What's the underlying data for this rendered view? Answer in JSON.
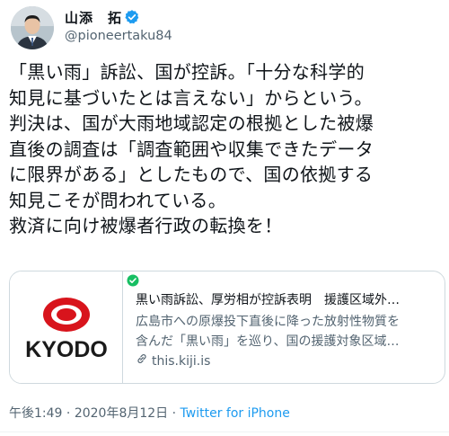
{
  "user": {
    "display_name": "山添　拓",
    "handle": "@pioneertaku84"
  },
  "tweet": {
    "text_lines": [
      "「黒い雨」訴訟、国が控訴。「十分な科学的",
      "知見に基づいたとは言えない」からという。",
      "判決は、国が大雨地域認定の根拠とした被爆",
      "直後の調査は「調査範囲や収集できたデータ",
      "に限界がある」としたもので、国の依拠する",
      "知見こそが問われている。",
      "救済に向け被爆者行政の転換を！"
    ]
  },
  "card": {
    "logo_text": "KYODO",
    "title": "黒い雨訴訟、厚労相が控訴表明　援護区域外…",
    "desc_line1": "広島市への原爆投下直後に降った放射性物質を",
    "desc_line2": "含んだ「黒い雨」を巡り、国の援護対象区域…",
    "domain": "this.kiji.is"
  },
  "meta": {
    "time": "午後1:49",
    "separator": " · ",
    "date": "2020年8月12日",
    "separator2": " · ",
    "source": "Twitter for iPhone"
  },
  "colors": {
    "verified": "#1d9bf0",
    "kyodo_red": "#d8141c",
    "check_green": "#17bf63"
  }
}
